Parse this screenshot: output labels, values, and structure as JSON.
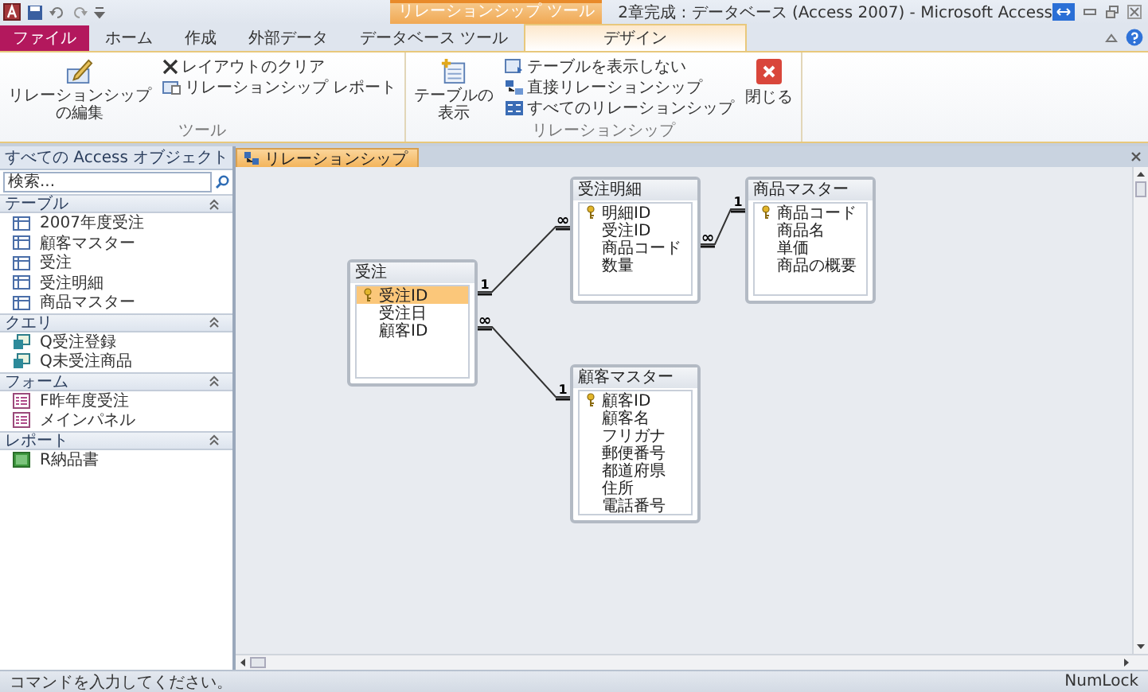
{
  "window": {
    "title": "2章完成 : データベース (Access 2007) - Microsoft Access",
    "context_group": "リレーションシップ ツール"
  },
  "ribbon_tabs": [
    {
      "label": "ファイル",
      "kind": "file",
      "selected": false
    },
    {
      "label": "ホーム",
      "kind": "tab",
      "selected": false
    },
    {
      "label": "作成",
      "kind": "tab",
      "selected": false
    },
    {
      "label": "外部データ",
      "kind": "tab",
      "selected": false
    },
    {
      "label": "データベース ツール",
      "kind": "tab",
      "selected": false
    },
    {
      "label": "デザイン",
      "kind": "context",
      "selected": true
    }
  ],
  "ribbon_groups": [
    {
      "label": "ツール",
      "buttons": [
        {
          "label": "リレーションシップ",
          "label2": "の編集",
          "kind": "large"
        },
        {
          "label": "レイアウトのクリア",
          "kind": "small"
        },
        {
          "label": "リレーションシップ レポート",
          "kind": "small"
        }
      ]
    },
    {
      "label": "リレーションシップ",
      "buttons": [
        {
          "label": "テーブルの",
          "label2": "表示",
          "kind": "large"
        },
        {
          "label": "テーブルを表示しない",
          "kind": "small"
        },
        {
          "label": "直接リレーションシップ",
          "kind": "small"
        },
        {
          "label": "すべてのリレーションシップ",
          "kind": "small"
        },
        {
          "label": "閉じる",
          "kind": "large"
        }
      ]
    }
  ],
  "nav_pane": {
    "title": "すべての Access オブジェクト",
    "search": {
      "placeholder": "検索..."
    },
    "groups": [
      {
        "label": "テーブル",
        "expanded": true,
        "items": [
          {
            "label": "2007年度受注",
            "kind": "table"
          },
          {
            "label": "顧客マスター",
            "kind": "table"
          },
          {
            "label": "受注",
            "kind": "table"
          },
          {
            "label": "受注明細",
            "kind": "table"
          },
          {
            "label": "商品マスター",
            "kind": "table"
          }
        ]
      },
      {
        "label": "クエリ",
        "expanded": true,
        "items": [
          {
            "label": "Q受注登録",
            "kind": "query"
          },
          {
            "label": "Q未受注商品",
            "kind": "query"
          }
        ]
      },
      {
        "label": "フォーム",
        "expanded": true,
        "items": [
          {
            "label": "F昨年度受注",
            "kind": "form"
          },
          {
            "label": "メインパネル",
            "kind": "form"
          }
        ]
      },
      {
        "label": "レポート",
        "expanded": true,
        "items": [
          {
            "label": "R納品書",
            "kind": "report"
          }
        ]
      }
    ]
  },
  "document_tab": {
    "label": "リレーションシップ"
  },
  "tables": [
    {
      "name": "受注",
      "fields": [
        {
          "name": "受注ID",
          "key": true,
          "selected": true
        },
        {
          "name": "受注日",
          "key": false,
          "selected": false
        },
        {
          "name": "顧客ID",
          "key": false,
          "selected": false
        }
      ]
    },
    {
      "name": "受注明細",
      "fields": [
        {
          "name": "明細ID",
          "key": true,
          "selected": false
        },
        {
          "name": "受注ID",
          "key": false,
          "selected": false
        },
        {
          "name": "商品コード",
          "key": false,
          "selected": false
        },
        {
          "name": "数量",
          "key": false,
          "selected": false
        }
      ]
    },
    {
      "name": "商品マスター",
      "fields": [
        {
          "name": "商品コード",
          "key": true,
          "selected": false
        },
        {
          "name": "商品名",
          "key": false,
          "selected": false
        },
        {
          "name": "単価",
          "key": false,
          "selected": false
        },
        {
          "name": "商品の概要",
          "key": false,
          "selected": false
        }
      ]
    },
    {
      "name": "顧客マスター",
      "fields": [
        {
          "name": "顧客ID",
          "key": true,
          "selected": false
        },
        {
          "name": "顧客名",
          "key": false,
          "selected": false
        },
        {
          "name": "フリガナ",
          "key": false,
          "selected": false
        },
        {
          "name": "郵便番号",
          "key": false,
          "selected": false
        },
        {
          "name": "都道府県",
          "key": false,
          "selected": false
        },
        {
          "name": "住所",
          "key": false,
          "selected": false
        },
        {
          "name": "電話番号",
          "key": false,
          "selected": false
        }
      ]
    }
  ],
  "relationships": [
    {
      "one_label": "1",
      "many_label": "∞"
    },
    {
      "one_label": "1",
      "many_label": "∞"
    },
    {
      "one_label": "1",
      "many_label": "∞"
    }
  ],
  "status_bar": {
    "message": "コマンドを入力してください。",
    "indicator": "NumLock"
  }
}
